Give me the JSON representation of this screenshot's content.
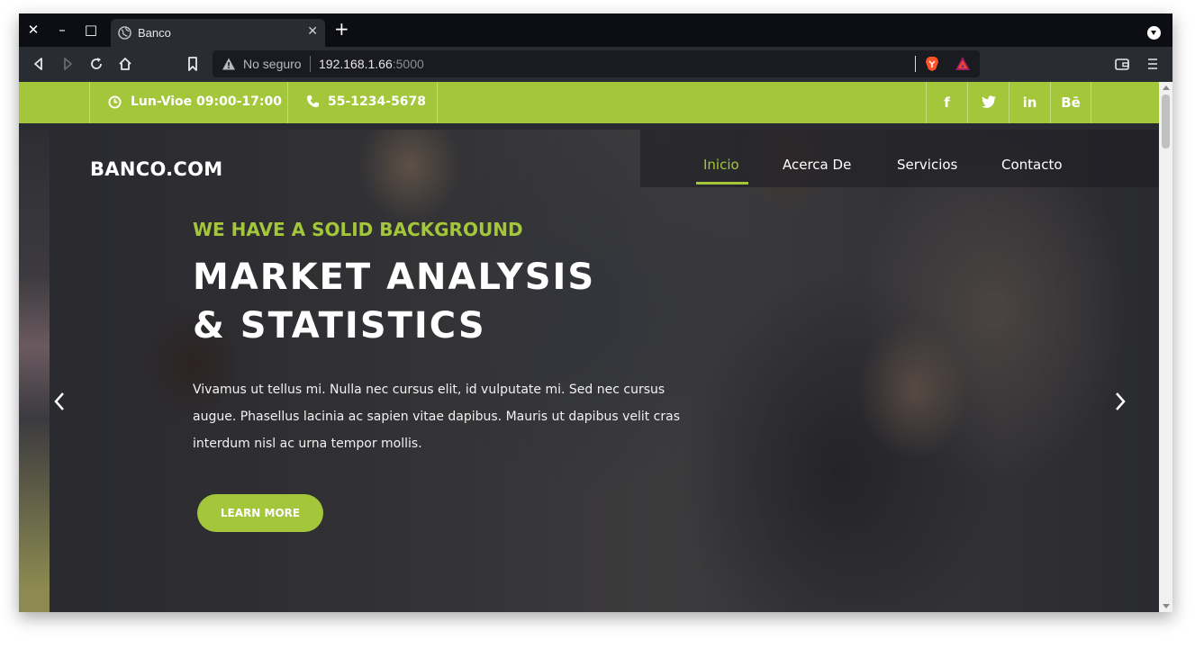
{
  "browser": {
    "tab_title": "Banco",
    "url_status": "No seguro",
    "url_host": "192.168.1.66",
    "url_port": ":5000",
    "icons": [
      "close-icon",
      "minimize-icon",
      "maximize-icon",
      "globe-icon",
      "plus-icon",
      "chevron-down-icon",
      "back-icon",
      "forward-icon",
      "reload-icon",
      "home-icon",
      "bookmark-icon",
      "warning-icon",
      "brave-shield-icon",
      "bat-rewards-icon",
      "wallet-icon",
      "menu-icon"
    ]
  },
  "topbar": {
    "hours": "Lun-Vioe 09:00-17:00",
    "phone": "55-1234-5678",
    "social": [
      "f",
      "t",
      "in",
      "Bē"
    ]
  },
  "site": {
    "brand": "BANCO.COM",
    "nav": [
      "Inicio",
      "Acerca De",
      "Servicios",
      "Contacto"
    ],
    "active_nav": "Inicio"
  },
  "hero": {
    "kicker": "WE HAVE A SOLID BACKGROUND",
    "headline_line1": "MARKET ANALYSIS",
    "headline_line2": "& STATISTICS",
    "body": "Vivamus ut tellus mi. Nulla nec cursus elit, id vulputate mi. Sed nec cursus augue. Phasellus lacinia ac sapien vitae dapibus. Mauris ut dapibus velit cras interdum nisl ac urna tempor mollis.",
    "cta": "LEARN MORE"
  },
  "colors": {
    "accent": "#a3c63a",
    "tabbar": "#0d0e13",
    "toolbar": "#2a2c33"
  }
}
